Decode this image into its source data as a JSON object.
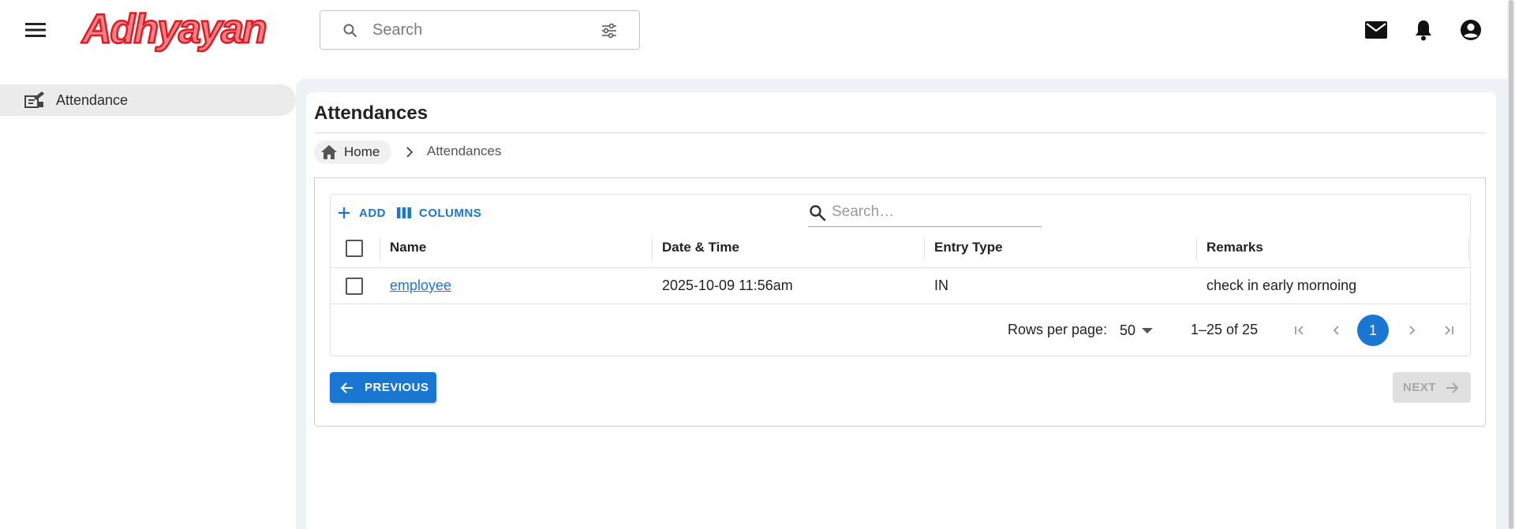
{
  "app": {
    "brand": "Adhyayan",
    "brand_color": "#e01b24",
    "accent_color": "#1976d2"
  },
  "topbar": {
    "menu_icon": "hamburger-menu-icon",
    "search_placeholder": "Search",
    "search_icon": "search-icon",
    "filter_icon": "tune-icon",
    "icons": [
      "mail-icon",
      "bell-icon",
      "account-circle-icon"
    ]
  },
  "sidebar": {
    "items": [
      {
        "label": "Attendance",
        "icon": "attendance-icon",
        "active": true
      }
    ]
  },
  "page": {
    "title": "Attendances",
    "breadcrumb": {
      "home": "Home",
      "current": "Attendances"
    }
  },
  "grid": {
    "toolbar": {
      "add_label": "ADD",
      "columns_label": "COLUMNS",
      "search_placeholder": "Search…"
    },
    "columns": [
      "Name",
      "Date & Time",
      "Entry Type",
      "Remarks"
    ],
    "rows": [
      {
        "name": "employee",
        "datetime": "2025-10-09 11:56am",
        "entry_type": "IN",
        "remarks": "check in early mornoing"
      }
    ],
    "pagination": {
      "rows_per_page_label": "Rows per page:",
      "rows_per_page": "50",
      "range": "1–25 of 25",
      "current_page": "1"
    }
  },
  "nav": {
    "previous_label": "PREVIOUS",
    "next_label": "NEXT",
    "next_enabled": false
  }
}
